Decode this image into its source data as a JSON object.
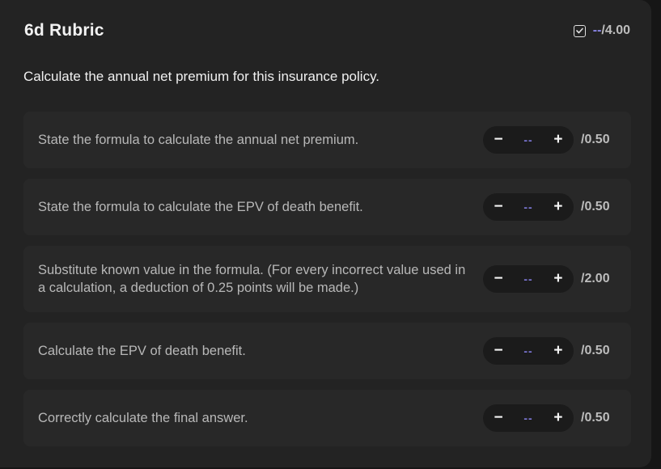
{
  "rubric": {
    "title": "6d Rubric",
    "total_score": "--",
    "total_max": "/4.00",
    "check_icon": "checkbox-icon",
    "question": "Calculate the annual net premium for this insurance policy."
  },
  "criteria": [
    {
      "text": "State the formula to calculate the annual net premium.",
      "score": "--",
      "max": "/0.50",
      "minus": "−",
      "plus": "+"
    },
    {
      "text": "State the formula to calculate the EPV of death benefit.",
      "score": "--",
      "max": "/0.50",
      "minus": "−",
      "plus": "+"
    },
    {
      "text": "Substitute known value in the formula. (For every incorrect value used in a calculation, a deduction of 0.25 points will be made.)",
      "score": "--",
      "max": "/2.00",
      "minus": "−",
      "plus": "+"
    },
    {
      "text": "Calculate the EPV of death benefit.",
      "score": "--",
      "max": "/0.50",
      "minus": "−",
      "plus": "+"
    },
    {
      "text": "Correctly calculate the final answer.",
      "score": "--",
      "max": "/0.50",
      "minus": "−",
      "plus": "+"
    }
  ],
  "colors": {
    "background": "#232323",
    "card": "#282828",
    "accent": "#8a85e6"
  }
}
